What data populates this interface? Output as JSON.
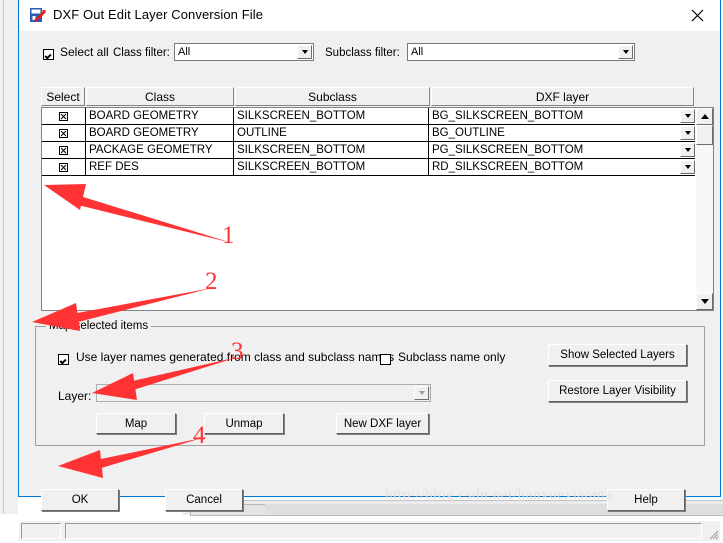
{
  "window": {
    "title": "DXF Out Edit Layer Conversion File",
    "icon": "dxf-app-icon",
    "close_icon": "close-icon"
  },
  "filters": {
    "select_all_label": "Select all",
    "select_all_checked": true,
    "class_filter_label": "Class filter:",
    "class_filter_value": "All",
    "subclass_filter_label": "Subclass filter:",
    "subclass_filter_value": "All"
  },
  "table": {
    "columns": [
      "Select",
      "Class",
      "Subclass",
      "DXF layer"
    ],
    "rows": [
      {
        "selected": true,
        "class": "BOARD GEOMETRY",
        "subclass": "SILKSCREEN_BOTTOM",
        "dxf_layer": "BG_SILKSCREEN_BOTTOM"
      },
      {
        "selected": true,
        "class": "BOARD GEOMETRY",
        "subclass": "OUTLINE",
        "dxf_layer": "BG_OUTLINE"
      },
      {
        "selected": true,
        "class": "PACKAGE GEOMETRY",
        "subclass": "SILKSCREEN_BOTTOM",
        "dxf_layer": "PG_SILKSCREEN_BOTTOM"
      },
      {
        "selected": true,
        "class": "REF DES",
        "subclass": "SILKSCREEN_BOTTOM",
        "dxf_layer": "RD_SILKSCREEN_BOTTOM"
      }
    ]
  },
  "map_group": {
    "title": "Map selected items",
    "use_layer_names_label": "Use layer names generated from class and subclass names",
    "use_layer_names_checked": true,
    "subclass_name_only_label": "Subclass name only",
    "subclass_name_only_checked": false,
    "layer_label": "Layer:",
    "layer_value": "",
    "map_button": "Map",
    "unmap_button": "Unmap",
    "new_dxf_layer_button": "New DXF layer",
    "show_selected_layers_button": "Show Selected Layers",
    "restore_layer_visibility_button": "Restore Layer Visibility"
  },
  "footer": {
    "ok_button": "OK",
    "cancel_button": "Cancel",
    "help_button": "Help"
  },
  "watermark": {
    "text": "http://blog.csdn.net/hanxuexiaoma"
  },
  "annotations": {
    "color": "#ff3333",
    "markers": [
      {
        "label": "1",
        "points_at": "table-rows"
      },
      {
        "label": "2",
        "points_at": "use-layer-names-checkbox"
      },
      {
        "label": "3",
        "points_at": "map-button"
      },
      {
        "label": "4",
        "points_at": "ok-button"
      }
    ]
  }
}
